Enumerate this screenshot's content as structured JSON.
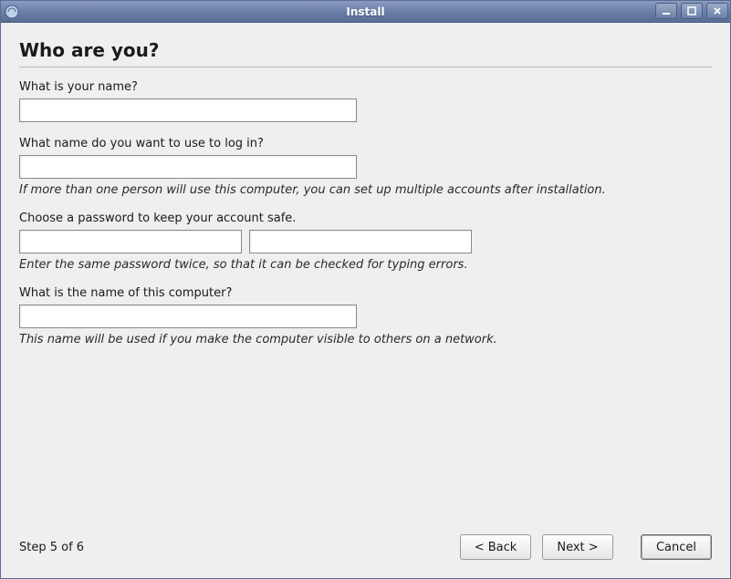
{
  "window": {
    "title": "Install"
  },
  "page": {
    "heading": "Who are you?"
  },
  "fields": {
    "name_label": "What is your name?",
    "name_value": "",
    "login_label": "What name do you want to use to log in?",
    "login_value": "",
    "login_hint": "If more than one person will use this computer, you can set up multiple accounts after installation.",
    "password_label": "Choose a password to keep your account safe.",
    "password_value": "",
    "password_confirm_value": "",
    "password_hint": "Enter the same password twice, so that it can be checked for typing errors.",
    "hostname_label": "What is the name of this computer?",
    "hostname_value": "",
    "hostname_hint": "This name will be used if you make the computer visible to others on a network."
  },
  "footer": {
    "step": "Step 5 of 6",
    "back": "< Back",
    "next": "Next >",
    "cancel": "Cancel"
  }
}
